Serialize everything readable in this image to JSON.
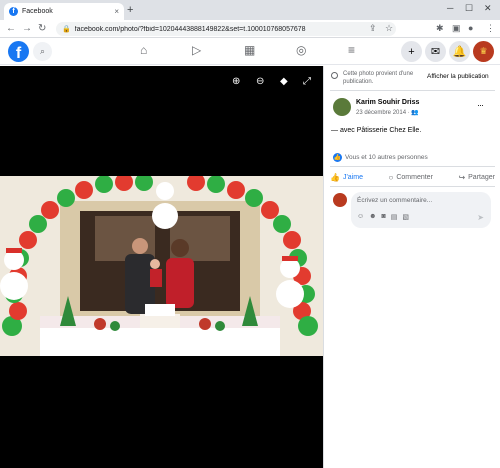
{
  "browser": {
    "tab_title": "Facebook",
    "tab_close": "×",
    "new_tab": "+",
    "url": "facebook.com/photo/?fbid=10204443888149822&set=t.100010768057678"
  },
  "photo_viewer": {
    "tools": [
      "zoom-in",
      "zoom-out",
      "tag",
      "fullscreen"
    ]
  },
  "panel": {
    "info_text": "Cette photo provient d'une publication.",
    "info_link": "Afficher la publication",
    "author": "Karim Souhir Driss",
    "date": "23 décembre 2014 · ",
    "more_label": "···",
    "with_prefix": "— avec ",
    "with_name": "Pâtisserie Chez Elle",
    "with_suffix": ".",
    "reactions_text": "Vous et 10 autres personnes",
    "actions": {
      "like": "J'aime",
      "comment": "Commenter",
      "share": "Partager"
    },
    "comment_placeholder": "Écrivez un commentaire..."
  },
  "colors": {
    "brand": "#1877f2",
    "viewer_bg": "#000000"
  }
}
